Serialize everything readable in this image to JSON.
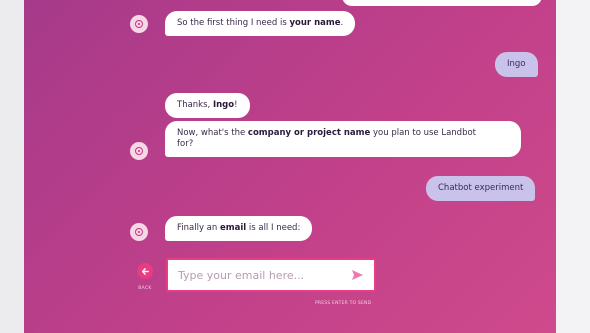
{
  "messages": {
    "m1": {
      "pre": "So the first thing I need is ",
      "bold": "your name",
      "post": "."
    },
    "m2": {
      "text": "Ingo"
    },
    "m3": {
      "pre": "Thanks, ",
      "bold": "Ingo",
      "post": "!"
    },
    "m4": {
      "line1_pre": "Now, what's the ",
      "bold": "company or project name",
      "line1_post": " you plan to use Landbot",
      "line2": "for?"
    },
    "m5": {
      "text": "Chatbot experiment"
    },
    "m6": {
      "pre": "Finally an ",
      "bold": "email",
      "post": " is all I need:"
    }
  },
  "input": {
    "placeholder": "Type your email here..."
  },
  "back": {
    "label": "BACK"
  },
  "hint": {
    "text": "PRESS ENTER TO SEND"
  },
  "icons": {
    "avatar": "bot-avatar-icon",
    "back": "arrow-left-icon",
    "send": "send-arrow-icon"
  },
  "colors": {
    "accent": "#e83c83",
    "user_bubble": "#c9c3ec",
    "bot_bubble": "#ffffff"
  }
}
